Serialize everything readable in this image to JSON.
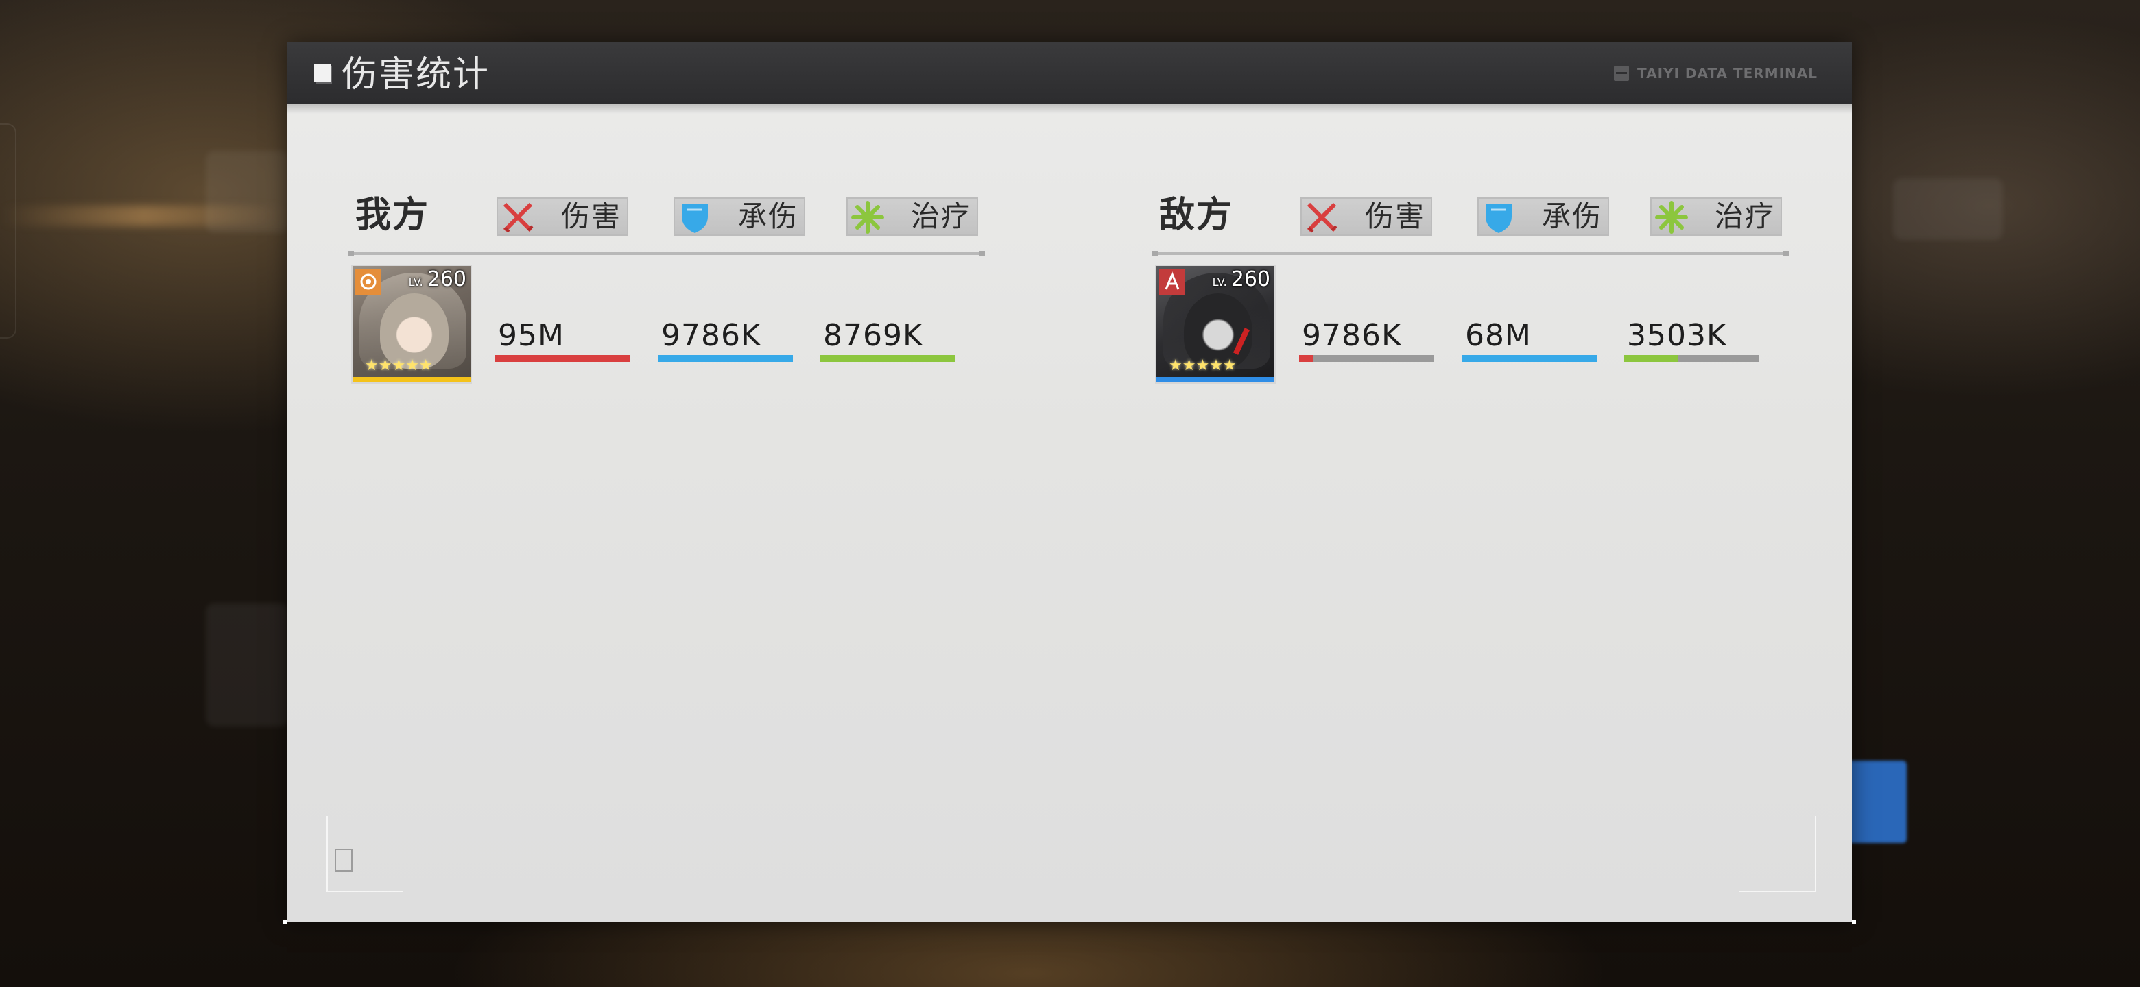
{
  "panel": {
    "title": "伤害统计",
    "terminal_label": "TAIYI DATA TERMINAL"
  },
  "tabs": {
    "damage": "伤害",
    "tanked": "承伤",
    "healing": "治疗"
  },
  "colors": {
    "damage": "#d93f3f",
    "tanked": "#37a9e8",
    "healing": "#8cc63e",
    "bar_bg": "#9a9a9a"
  },
  "ally": {
    "label": "我方",
    "units": [
      {
        "level_prefix": "LV.",
        "level": "260",
        "stars": "★★★★★",
        "rarity_color": "#f4c21a",
        "damage": {
          "text": "95M",
          "ratio": 1.0
        },
        "tanked": {
          "text": "9786K",
          "ratio": 1.0
        },
        "healing": {
          "text": "8769K",
          "ratio": 1.0
        }
      }
    ]
  },
  "enemy": {
    "label": "敌方",
    "units": [
      {
        "level_prefix": "LV.",
        "level": "260",
        "stars": "★★★★★",
        "rarity_color": "#2f8de6",
        "damage": {
          "text": "9786K",
          "ratio": 0.1
        },
        "tanked": {
          "text": "68M",
          "ratio": 1.0
        },
        "healing": {
          "text": "3503K",
          "ratio": 0.4
        }
      }
    ]
  }
}
